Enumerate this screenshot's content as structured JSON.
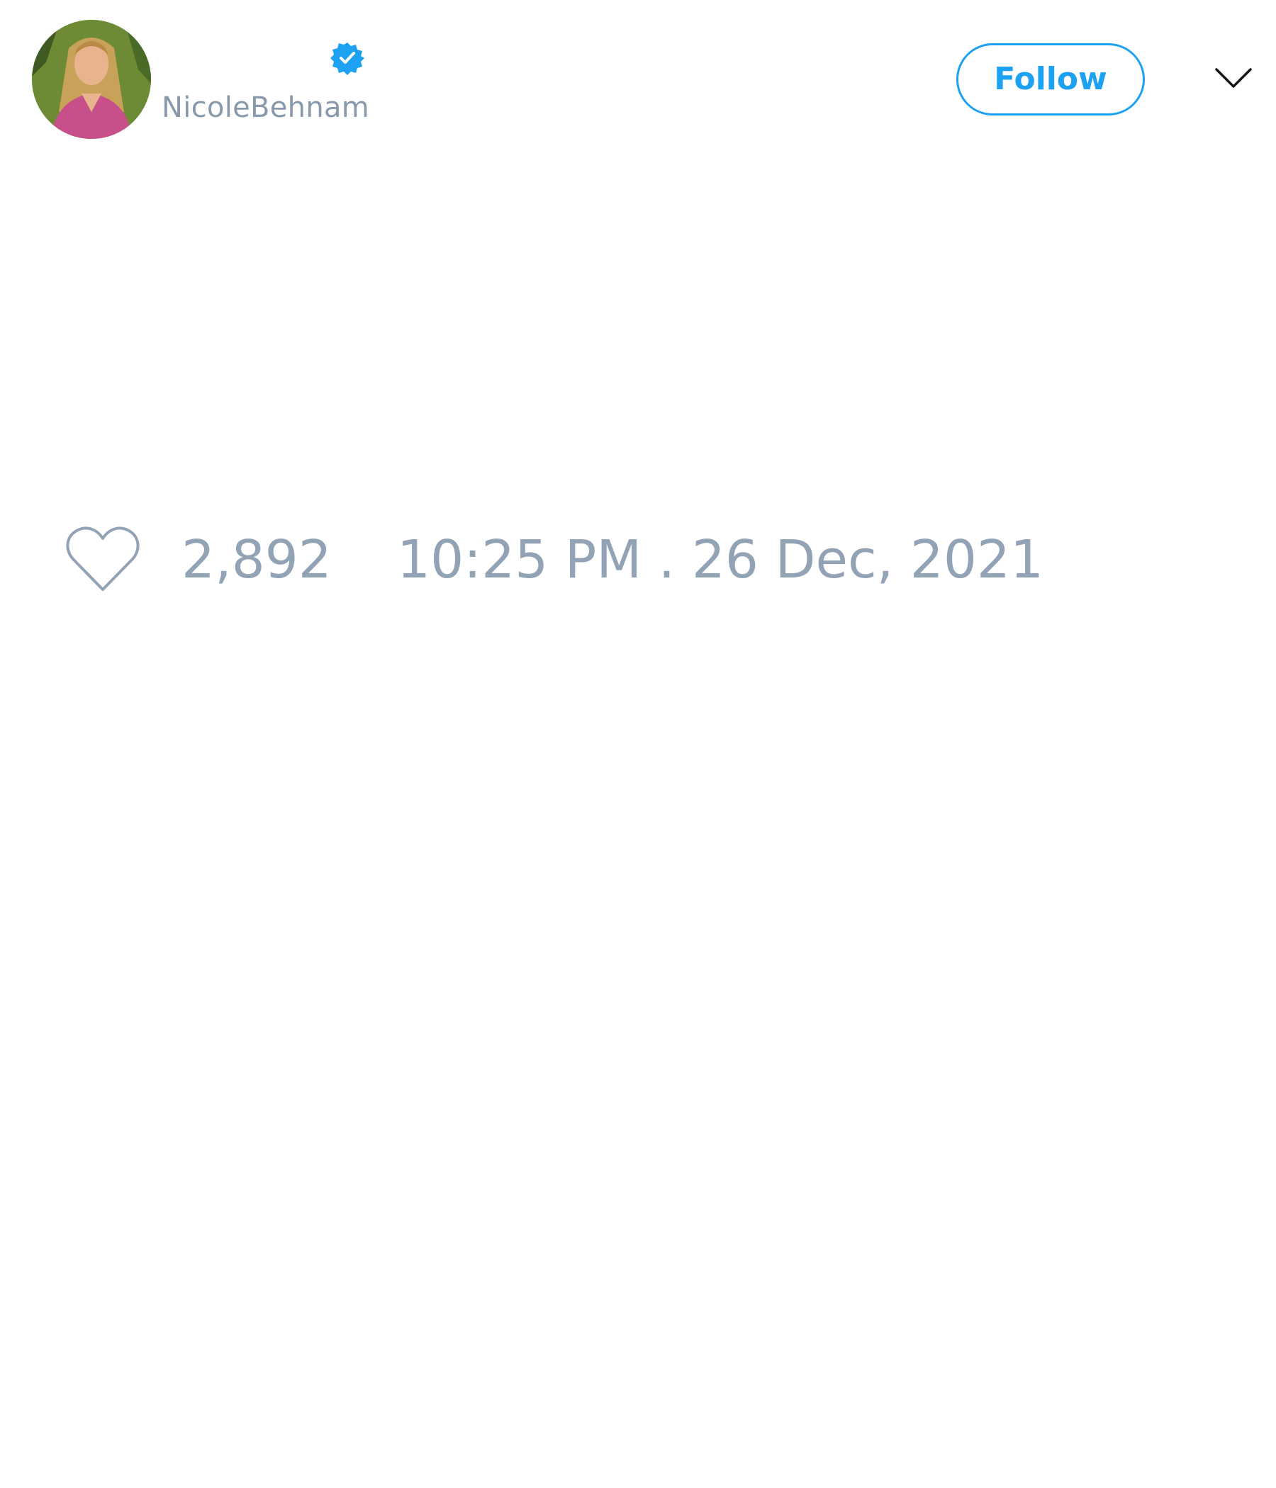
{
  "tweet": {
    "display_name": "",
    "handle": "NicoleBehnam",
    "verified": true,
    "text": "",
    "likes": "2,892",
    "timestamp": "10:25 PM . 26 Dec, 2021"
  },
  "header": {
    "follow_label": "Follow"
  },
  "icons": {
    "avatar": "avatar-photo",
    "verified": "verified-badge-icon",
    "more": "chevron-down-icon",
    "like": "heart-icon"
  },
  "colors": {
    "accent": "#1da1f2",
    "muted": "#93a3b6",
    "handle": "#8899ac",
    "text": "#14171a",
    "background": "#ffffff"
  }
}
